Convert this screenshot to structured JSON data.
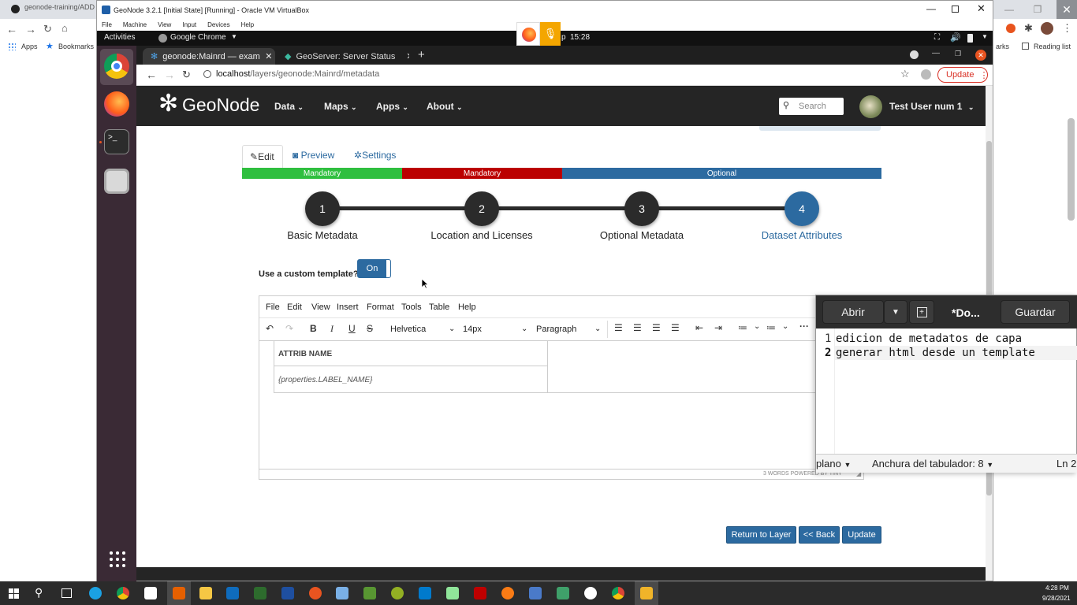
{
  "host": {
    "tab_title": "geonode-training/ADD",
    "bookmarks": [
      "Apps",
      "Bookmarks"
    ],
    "bookmarks_right": [
      "arks",
      "Reading list"
    ]
  },
  "vbox": {
    "title": "GeoNode 3.2.1 [Initial State] [Running] - Oracle VM VirtualBox",
    "menu": [
      "File",
      "Machine",
      "View",
      "Input",
      "Devices",
      "Help"
    ]
  },
  "ubuntu": {
    "activities": "Activities",
    "app_name": "Google Chrome",
    "clock_fragment": "p",
    "clock": "15:28"
  },
  "guest_chrome": {
    "tabs": [
      "geonode:Mainrd — exam",
      "GeoServer: Server Status"
    ],
    "url_host": "localhost",
    "url_path": "/layers/geonode:Mainrd/metadata",
    "update_label": "Update"
  },
  "geonode": {
    "logo": "GeoNode",
    "menu": [
      "Data",
      "Maps",
      "Apps",
      "About"
    ],
    "search_placeholder": "Search",
    "user": "Test User num 1",
    "tabs": [
      "Edit",
      "Preview",
      "Settings"
    ],
    "progress": [
      {
        "label": "Mandatory",
        "color": "#2fbf3f"
      },
      {
        "label": "Mandatory",
        "color": "#bb0000"
      },
      {
        "label": "Optional",
        "color": "#2c6aa0"
      }
    ],
    "steps": [
      {
        "num": "1",
        "label": "Basic Metadata"
      },
      {
        "num": "2",
        "label": "Location and Licenses"
      },
      {
        "num": "3",
        "label": "Optional Metadata"
      },
      {
        "num": "4",
        "label": "Dataset Attributes"
      }
    ],
    "custom_template_label": "Use a custom template?",
    "toggle_label": "On",
    "editor": {
      "menu": [
        "File",
        "Edit",
        "View",
        "Insert",
        "Format",
        "Tools",
        "Table",
        "Help"
      ],
      "font": "Helvetica",
      "size": "14px",
      "block": "Paragraph",
      "table_header": "ATTRIB NAME",
      "table_cell": "{properties.LABEL_NAME}",
      "status": "3 WORDS  POWERED BY TINY"
    },
    "buttons": [
      "Return to Layer",
      "<< Back",
      "Update"
    ]
  },
  "gedit": {
    "open": "Abrir",
    "doc": "*Do...",
    "save": "Guardar",
    "lines": [
      {
        "num": "1",
        "text": "edicion de metadatos de capa"
      },
      {
        "num": "2",
        "text": "generar html desde un template"
      }
    ],
    "syntax": "plano",
    "tab_width": "Anchura del tabulador: 8",
    "position": "Ln 2"
  },
  "taskbar": {
    "time": "4:28 PM",
    "date": "9/28/2021"
  },
  "colors": {
    "accent": "#2c6aa0",
    "green": "#2fbf3f",
    "red": "#bb0000",
    "ubuntu_dock": "#3a2a35"
  }
}
